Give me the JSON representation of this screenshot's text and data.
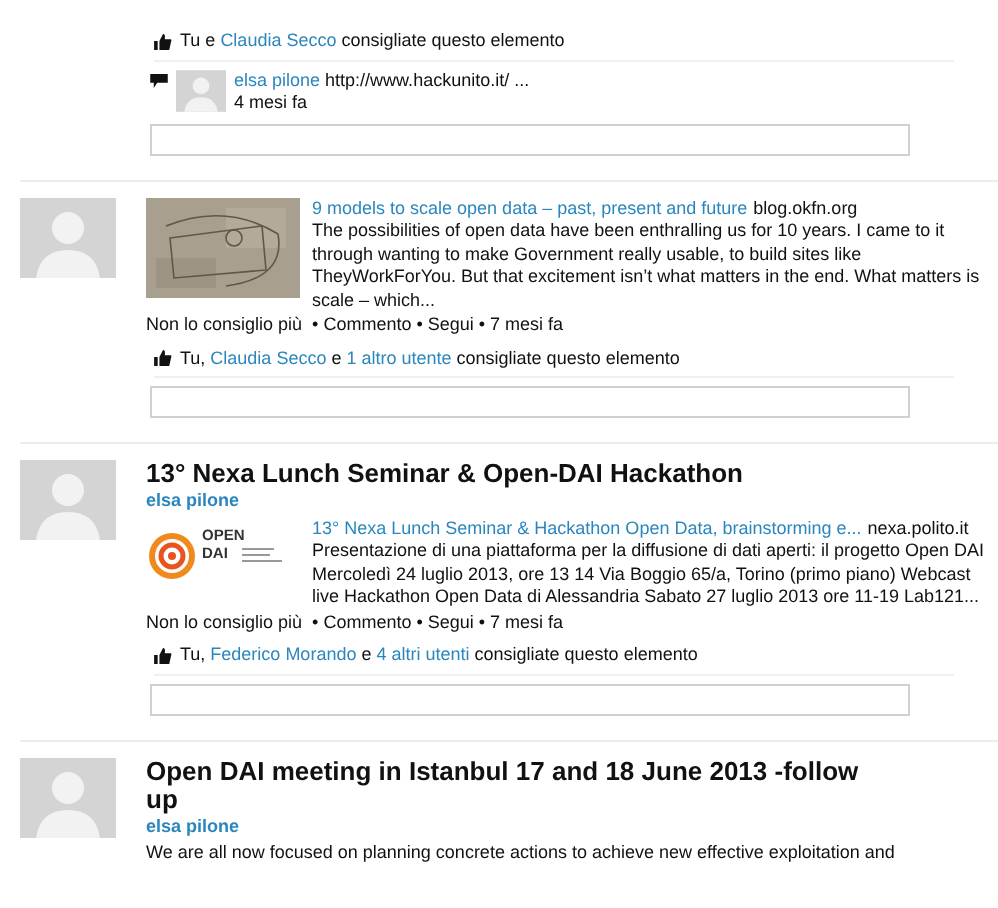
{
  "posts": [
    {
      "likes": [
        {
          "text": "Tu e "
        },
        {
          "text": "Claudia Secco",
          "link": true
        },
        {
          "text": " consigliate questo elemento"
        }
      ],
      "comments": [
        {
          "author": "elsa pilone",
          "text": "http://www.hackunito.it/ ...",
          "time": "4 mesi fa"
        }
      ]
    },
    {
      "avatar": true,
      "attachment": {
        "title": "9 models to scale open data – past, present and future",
        "source": "blog.okfn.org",
        "description": "The possibilities of open data have been enthralling us for 10 years. I came to it through wanting to make Government really usable, to build sites like TheyWorkForYou. But that excitement isn’t what matters in the end. What matters is scale – which..."
      },
      "actions": "Non lo consiglio più  • Commento • Segui • 7 mesi fa",
      "likes": [
        {
          "text": "Tu, "
        },
        {
          "text": "Claudia Secco",
          "link": true
        },
        {
          "text": " e "
        },
        {
          "text": "1 altro utente",
          "link": true
        },
        {
          "text": " consigliate questo elemento"
        }
      ]
    },
    {
      "avatar": true,
      "title": "13° Nexa Lunch Seminar & Open-DAI Hackathon",
      "author": "elsa pilone",
      "attachment": {
        "kind": "logo",
        "logo_text": [
          "OPEN",
          "DAI"
        ],
        "title": "13° Nexa Lunch Seminar & Hackathon Open Data, brainstorming e...",
        "source": "nexa.polito.it",
        "description": "Presentazione di una piattaforma per la diffusione di dati aperti: il progetto Open DAI Mercoledì 24 luglio 2013, ore 13 14 Via Boggio 65/a, Torino (primo piano) Webcast live Hackathon Open Data di Alessandria Sabato 27 luglio 2013 ore 11-19 Lab121..."
      },
      "actions": "Non lo consiglio più  • Commento • Segui • 7 mesi fa",
      "likes": [
        {
          "text": "Tu, "
        },
        {
          "text": "Federico Morando",
          "link": true
        },
        {
          "text": " e "
        },
        {
          "text": "4 altri utenti",
          "link": true
        },
        {
          "text": " consigliate questo elemento"
        }
      ]
    },
    {
      "avatar": true,
      "title": "Open DAI meeting in Istanbul 17 and 18 June 2013 -follow up",
      "author": "elsa pilone",
      "text": "We are all now focused on planning concrete actions to achieve new effective exploitation and"
    }
  ]
}
